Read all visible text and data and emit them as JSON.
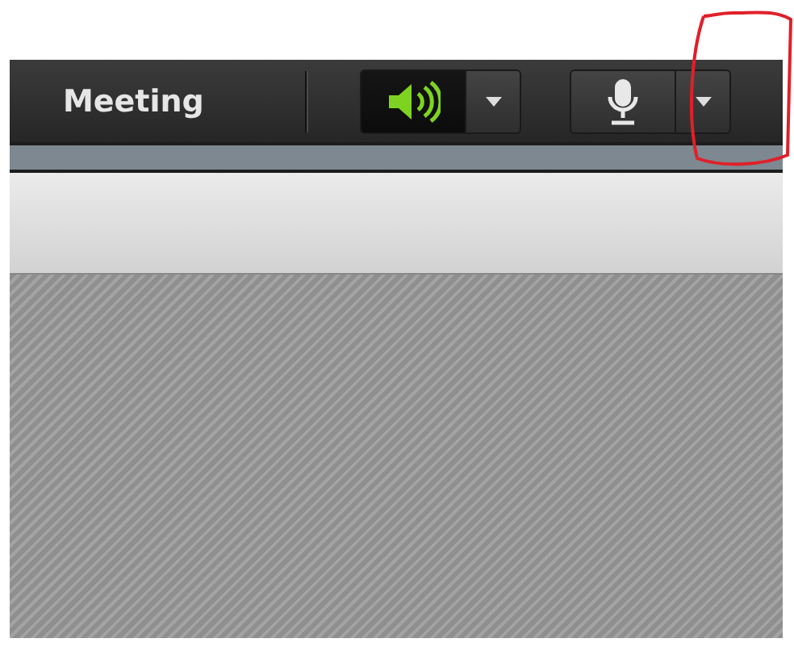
{
  "toolbar": {
    "title": "Meeting",
    "controls": [
      {
        "kind": "speaker",
        "active": true
      },
      {
        "kind": "microphone",
        "active": false
      }
    ]
  }
}
